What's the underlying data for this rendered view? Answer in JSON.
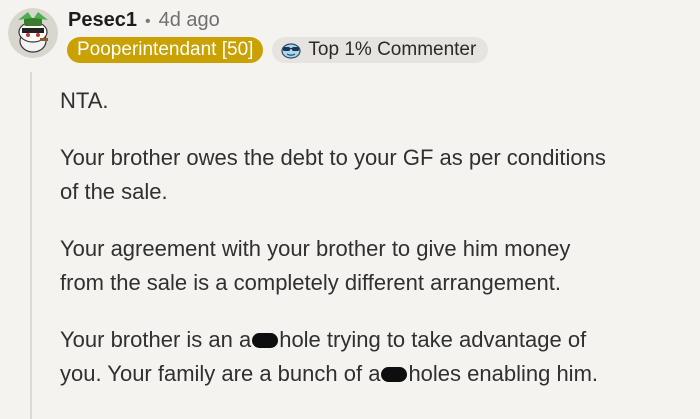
{
  "comment": {
    "username": "Pesec1",
    "separator": "•",
    "timestamp": "4d ago",
    "flair": "Pooperintendant [50]",
    "badge_label": "Top 1% Commenter",
    "badge_icon": "sunglasses-face-icon",
    "avatar_icon": "snoo-avatar-icon",
    "colors": {
      "flair_bg": "#c9a100",
      "background": "#f5f3f0",
      "badge_bg": "#e7e4df"
    },
    "body": {
      "p1": "NTA.",
      "p2_line1": "Your brother owes the debt to your GF as per conditions",
      "p2_line2": "of the sale.",
      "p3_line1": "Your agreement with your brother to give him money",
      "p3_line2": "from the sale is a completely different arrangement.",
      "p4_line1_a": "Your brother is an a",
      "p4_line1_b": "hole trying to take advantage of",
      "p4_line2_a": "you. Your family are a bunch of a",
      "p4_line2_b": "holes enabling him."
    }
  }
}
